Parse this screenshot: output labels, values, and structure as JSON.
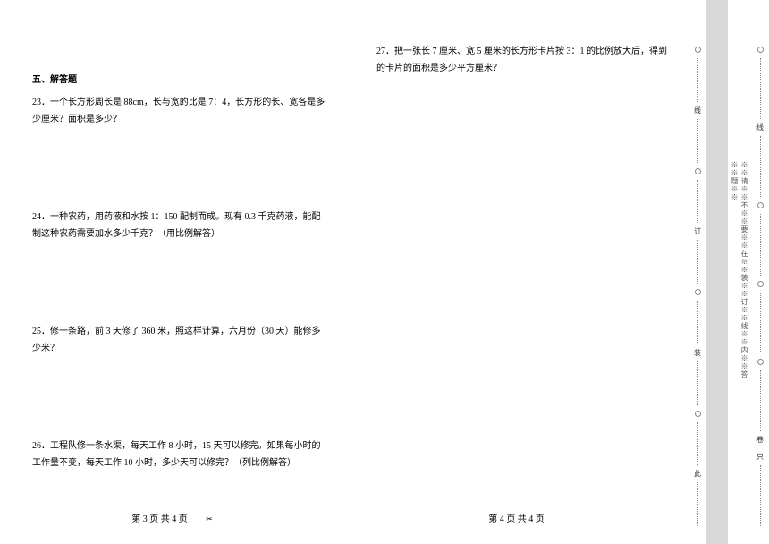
{
  "section": {
    "title": "五、解答题"
  },
  "questions": {
    "q23": "23．一个长方形周长是 88cm，长与宽的比是 7：4，长方形的长、宽各是多少厘米？面积是多少？",
    "q24": "24．一种农药，用药液和水按 1：150 配制而成。现有 0.3 千克药液，能配制这种农药需要加水多少千克？（用比例解答）",
    "q25": "25．修一条路，前 3 天修了 360 米，照这样计算，六月份（30 天）能修多少米？",
    "q26": "26．工程队修一条水渠，每天工作 8 小时，15 天可以修完。如果每小时的工作量不变，每天工作 10 小时，多少天可以修完？（列比例解答）",
    "q27": "27．把一张长 7 厘米、宽 5 厘米的长方形卡片按 3：1 的比例放大后，得到的卡片的面积是多少平方厘米？"
  },
  "footer": {
    "page3": "第 3 页  共 4 页",
    "page4": "第 4 页  共 4 页",
    "scissors": "✂"
  },
  "binding": {
    "note": "※※请※※不※※要※※在※※装※※订※※线※※内※※答※※题※※",
    "c1": "线",
    "c2": "订",
    "c3": "装",
    "c4": "此",
    "c5": "卷",
    "c6": "只"
  }
}
